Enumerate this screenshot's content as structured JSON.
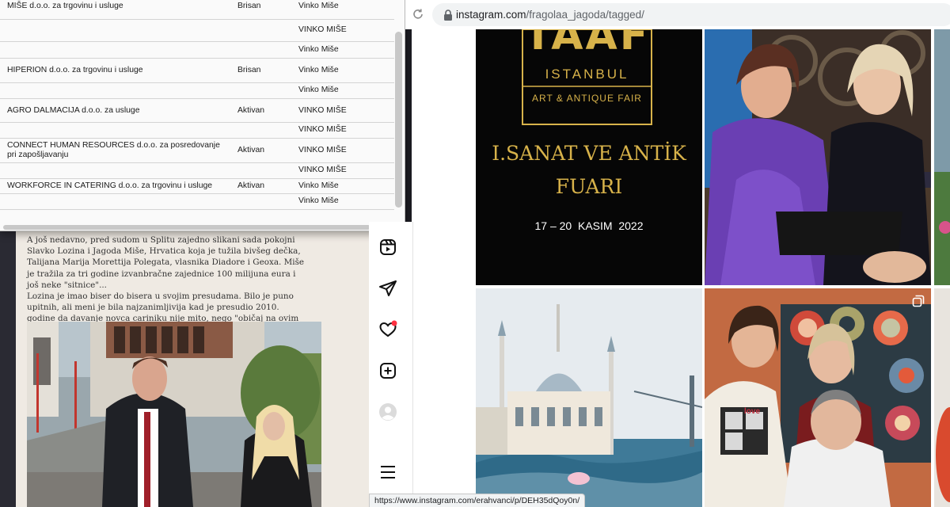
{
  "spreadsheet": {
    "rows": [
      {
        "name": "MIŠE d.o.o. za trgovinu i usluge",
        "status": "Brisan",
        "owner": "Vinko Miše"
      },
      {
        "name": "",
        "status": "",
        "owner": "VINKO MIŠE"
      },
      {
        "name": "",
        "status": "",
        "owner": "Vinko Miše"
      },
      {
        "name": "HIPERION d.o.o. za trgovinu i usluge",
        "status": "Brisan",
        "owner": "Vinko Miše"
      },
      {
        "name": "",
        "status": "",
        "owner": "Vinko Miše"
      },
      {
        "name": "AGRO DALMACIJA d.o.o. za usluge",
        "status": "Aktivan",
        "owner": "VINKO MIŠE"
      },
      {
        "name": "",
        "status": "",
        "owner": "VINKO MIŠE"
      },
      {
        "name": "CONNECT HUMAN RESOURCES d.o.o. za posredovanje pri zapošljavanju",
        "status": "Aktivan",
        "owner": "VINKO MIŠE"
      },
      {
        "name": "",
        "status": "",
        "owner": "VINKO MIŠE"
      },
      {
        "name": "WORKFORCE IN CATERING d.o.o. za trgovinu i usluge",
        "status": "Aktivan",
        "owner": "Vinko Miše"
      },
      {
        "name": "",
        "status": "",
        "owner": "Vinko Miše"
      }
    ]
  },
  "article": {
    "paragraph1": "A još nedavno, pred sudom u Splitu zajedno slikani sada pokojni Slavko Lozina i Jagoda Miše, Hrvatica koja je tužila bivšeg dečka, Talijana Marija Morettija Polegata, vlasnika Diadore i Geoxa. Miše je tražila za tri godine izvanbračne zajednice 100 milijuna eura i još neke \"sitnice\"...",
    "paragraph2": "Lozina je imao biser do bisera u svojim presudama. Bilo je puno upitnih, ali meni je bila najzanimljivija kad je presudio 2010. godine da davanje novca cariniku nije mito, nego \"običaj na ovim prostorima\"."
  },
  "browser": {
    "url_domain": "instagram.com",
    "url_path": "/fragolaa_jagoda/tagged/",
    "status_url": "https://www.instagram.com/erahvanci/p/DEH35dQoy0n/"
  },
  "posts": {
    "fair": {
      "logo": "TAAF",
      "city": "ISTANBUL",
      "subtitle": "ART & ANTIQUE FAIR",
      "headline1": "I.SANAT VE ANTİK",
      "headline2": "FUARI",
      "dates": "17 – 20  KASIM  2022"
    },
    "sweater_text": "love"
  },
  "sidebar": {
    "icons": [
      "reels-icon",
      "messages-icon",
      "notifications-icon",
      "create-icon",
      "profile-icon",
      "more-menu-icon"
    ]
  },
  "colors": {
    "fair_gold": "#d7b24a",
    "ig_notification": "#ff3040"
  }
}
